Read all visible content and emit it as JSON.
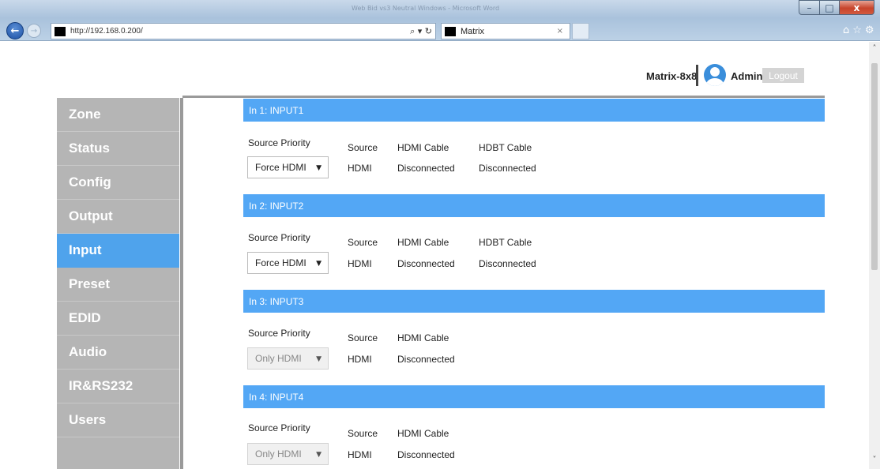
{
  "browser": {
    "window_title": "Web Bid vs3 Neutral Windows - Microsoft Word",
    "address": "http://192.168.0.200/",
    "addr_tools": "⌕ ▾ ↻",
    "tab_title": "Matrix",
    "tab_close": "×",
    "back": "←",
    "forward": "→",
    "min": "–",
    "max": "□",
    "close": "x",
    "tools": "⌂☆⚙"
  },
  "header": {
    "device_name": "Matrix-8x8",
    "user": "Admin",
    "logout_label": "Logout"
  },
  "nav": {
    "items": [
      "Zone",
      "Status",
      "Config",
      "Output",
      "Input",
      "Preset",
      "EDID",
      "Audio",
      "IR&RS232",
      "Users"
    ],
    "active": "Input"
  },
  "inputs": [
    {
      "title": "In 1: INPUT1",
      "labels": {
        "priority": "Source Priority",
        "source": "Source",
        "hdmi_cable": "HDMI Cable",
        "hdbt_cable": "HDBT Cable"
      },
      "priority_value": "Force HDMI",
      "source_value": "HDMI",
      "hdmi_cable_value": "Disconnected",
      "hdbt_cable_value": "Disconnected",
      "disabled": false
    },
    {
      "title": "In 2: INPUT2",
      "labels": {
        "priority": "Source Priority",
        "source": "Source",
        "hdmi_cable": "HDMI Cable",
        "hdbt_cable": "HDBT Cable"
      },
      "priority_value": "Force HDMI",
      "source_value": "HDMI",
      "hdmi_cable_value": "Disconnected",
      "hdbt_cable_value": "Disconnected",
      "disabled": false
    },
    {
      "title": "In 3: INPUT3",
      "labels": {
        "priority": "Source Priority",
        "source": "Source",
        "hdmi_cable": "HDMI Cable"
      },
      "priority_value": "Only HDMI",
      "source_value": "HDMI",
      "hdmi_cable_value": "Disconnected",
      "disabled": true
    },
    {
      "title": "In 4: INPUT4",
      "labels": {
        "priority": "Source Priority",
        "source": "Source",
        "hdmi_cable": "HDMI Cable"
      },
      "priority_value": "Only HDMI",
      "source_value": "HDMI",
      "hdmi_cable_value": "Disconnected",
      "disabled": true
    }
  ],
  "icons": {
    "caret": "▼",
    "scroll_up": "˄",
    "scroll_down": "˅"
  },
  "colors": {
    "accent": "#53a7f5",
    "nav_active": "#4fa3ec",
    "nav_bg": "#b5b5b5"
  }
}
